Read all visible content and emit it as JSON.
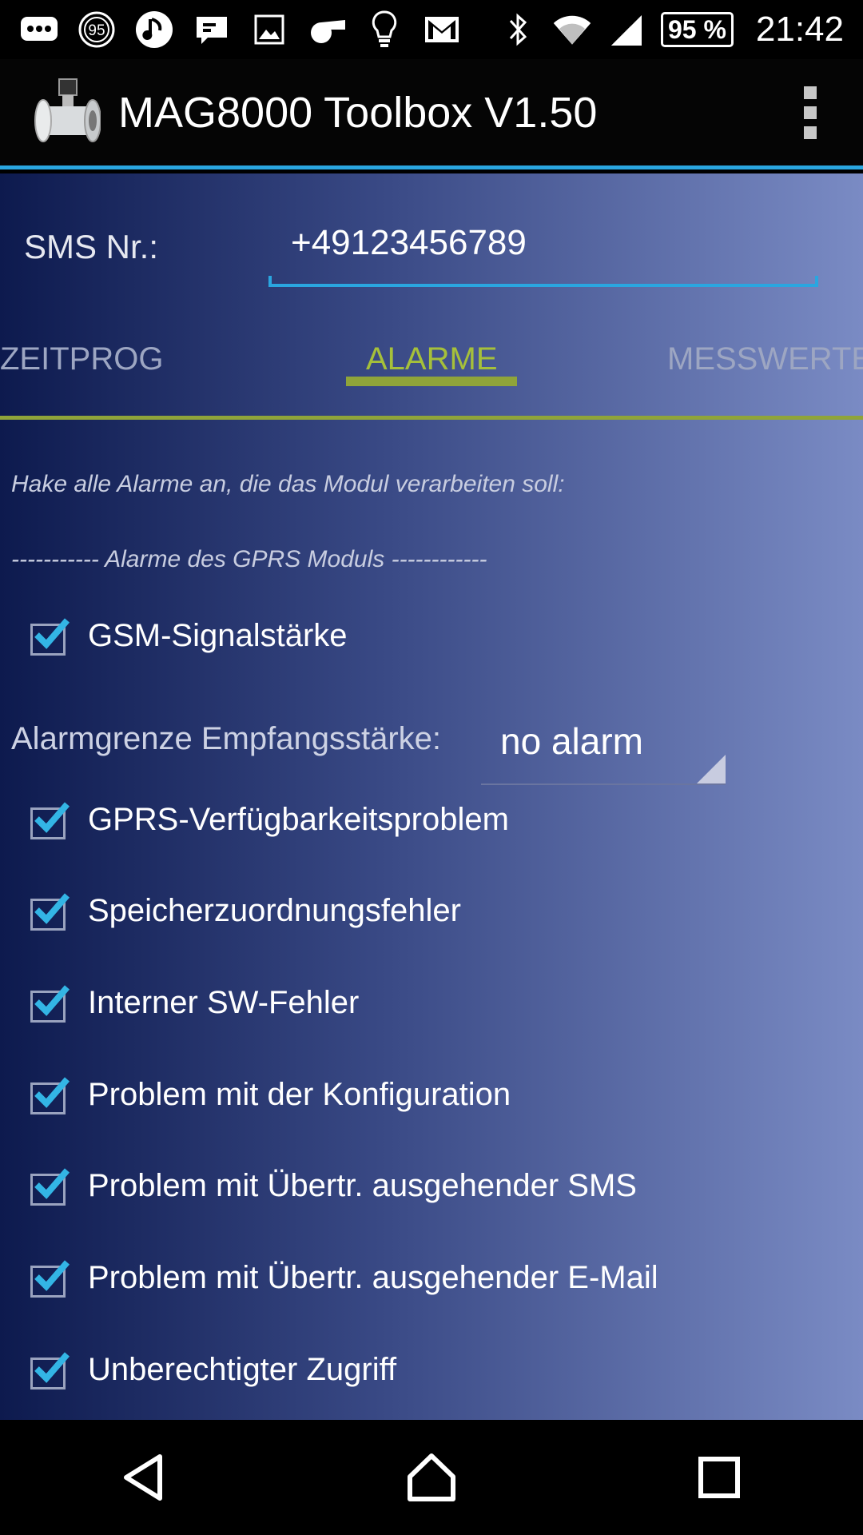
{
  "status_bar": {
    "battery": "95 %",
    "time": "21:42",
    "icons_left": [
      "chat-bubble-icon",
      "badge-95-icon",
      "music-note-icon",
      "message-icon",
      "picture-icon",
      "whistle-icon",
      "lightbulb-icon",
      "gmail-icon"
    ],
    "icons_right": [
      "bluetooth-icon",
      "wifi-icon",
      "cell-signal-icon",
      "battery-icon"
    ],
    "badge_number": "95"
  },
  "app_bar": {
    "title": "MAG8000 Toolbox V1.50",
    "logo": "flowmeter-logo-icon",
    "menu": "overflow-menu-icon"
  },
  "sms": {
    "label": "SMS Nr.:",
    "value": "+49123456789"
  },
  "tabs": [
    {
      "label": "ZEITPROG",
      "active": false
    },
    {
      "label": "ALARME",
      "active": true
    },
    {
      "label": "MESSWERTE",
      "active": false
    }
  ],
  "hint": "Hake alle Alarme an, die das Modul verarbeiten soll:",
  "section_header": "----------- Alarme des GPRS Moduls ------------",
  "alarms": [
    {
      "label": "GSM-Signalstärke",
      "checked": true
    },
    {
      "label": "GPRS-Verfügbarkeitsproblem",
      "checked": true
    },
    {
      "label": "Speicherzuordnungsfehler",
      "checked": true
    },
    {
      "label": "Interner SW-Fehler",
      "checked": true
    },
    {
      "label": "Problem mit der Konfiguration",
      "checked": true
    },
    {
      "label": "Problem mit Übertr. ausgehender SMS",
      "checked": true
    },
    {
      "label": "Problem mit Übertr. ausgehender E-Mail",
      "checked": true
    },
    {
      "label": "Unberechtigter Zugriff",
      "checked": true
    }
  ],
  "signal_limit": {
    "label": "Alarmgrenze Empfangsstärke:",
    "value": "no alarm"
  },
  "nav_bar": [
    "back-icon",
    "home-icon",
    "recents-icon"
  ],
  "colors": {
    "accent_blue": "#2aa6e0",
    "tab_green": "#8fa43a",
    "active_tab_text": "#a6c03a",
    "check_blue": "#33b5e5"
  }
}
